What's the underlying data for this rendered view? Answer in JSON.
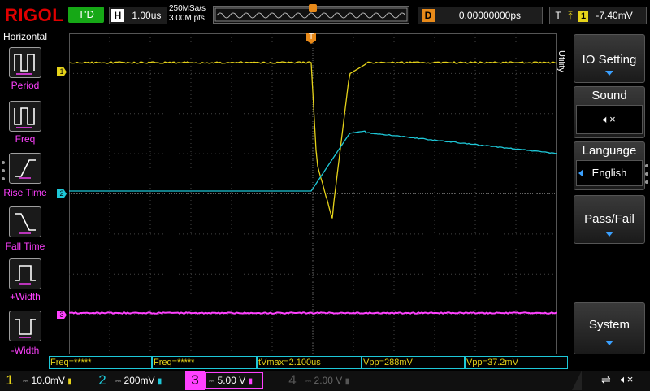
{
  "brand": "RIGOL",
  "run_state": "T'D",
  "horizontal": {
    "key": "H",
    "timebase": "1.00us",
    "sample_rate": "250MSa/s",
    "memory_depth": "3.00M pts"
  },
  "delay": {
    "key": "D",
    "value": "0.00000000ps"
  },
  "trigger": {
    "key": "T",
    "edge_icon": "rising-falling-edge-icon",
    "source": "1",
    "level": "-7.40mV"
  },
  "left_menu": {
    "title": "Horizontal",
    "items": [
      {
        "label": "Period",
        "icon": "period-icon"
      },
      {
        "label": "Freq",
        "icon": "frequency-icon"
      },
      {
        "label": "Rise Time",
        "icon": "rise-time-icon"
      },
      {
        "label": "Fall Time",
        "icon": "fall-time-icon"
      },
      {
        "label": "+Width",
        "icon": "positive-width-icon"
      },
      {
        "label": "-Width",
        "icon": "negative-width-icon"
      }
    ]
  },
  "channel_markers": {
    "ch1": "1",
    "ch2": "2",
    "ch3": "3"
  },
  "trigger_marker": "T",
  "right_menu": {
    "title": "Utility",
    "io_setting": "IO Setting",
    "sound": "Sound",
    "sound_icon": "speaker-muted-icon",
    "language": "Language",
    "language_value": "English",
    "pass_fail": "Pass/Fail",
    "system": "System"
  },
  "measurements": [
    {
      "text": "Freq=*****"
    },
    {
      "text": "Freq=*****"
    },
    {
      "text": "tVmax=2.100us"
    },
    {
      "text": "Vpp=288mV"
    },
    {
      "text": "Vpp=37.2mV"
    }
  ],
  "channels": [
    {
      "num": "1",
      "scale": "10.0mV",
      "color": "#e6d31a"
    },
    {
      "num": "2",
      "scale": "200mV",
      "color": "#1ec8d8"
    },
    {
      "num": "3",
      "scale": "5.00 V",
      "color": "#ff41ff"
    },
    {
      "num": "4",
      "scale": "2.00 V",
      "color": "#555555"
    }
  ],
  "status_icons": [
    "usb-icon",
    "speaker-muted-icon"
  ],
  "colors": {
    "ch1": "#e6d31a",
    "ch2": "#1ec8d8",
    "ch3": "#ff41ff",
    "trigger": "#e88a1a",
    "brand": "#e00000",
    "menu_label": "#ff41ff"
  }
}
